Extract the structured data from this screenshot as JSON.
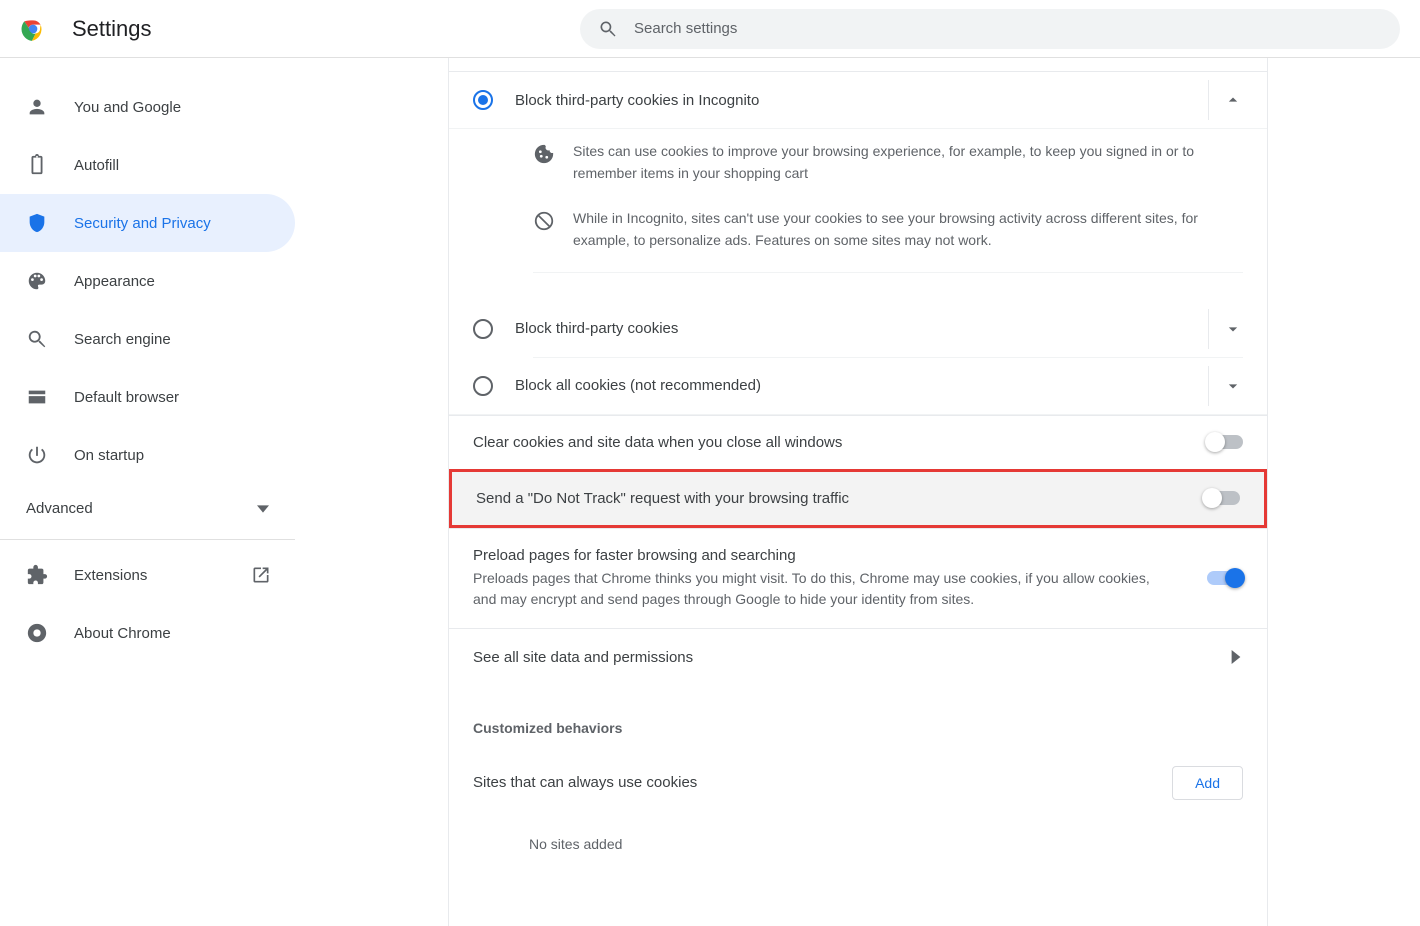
{
  "header": {
    "title": "Settings",
    "search_placeholder": "Search settings"
  },
  "sidebar": {
    "items": [
      {
        "label": "You and Google"
      },
      {
        "label": "Autofill"
      },
      {
        "label": "Security and Privacy"
      },
      {
        "label": "Appearance"
      },
      {
        "label": "Search engine"
      },
      {
        "label": "Default browser"
      },
      {
        "label": "On startup"
      }
    ],
    "advanced_label": "Advanced",
    "extensions_label": "Extensions",
    "about_label": "About Chrome"
  },
  "cookies": {
    "opt_selected": "Block third-party cookies in Incognito",
    "opt_selected_detail1": "Sites can use cookies to improve your browsing experience, for example, to keep you signed in or to remember items in your shopping cart",
    "opt_selected_detail2": "While in Incognito, sites can't use your cookies to see your browsing activity across different sites, for example, to personalize ads. Features on some sites may not work.",
    "opt_block_third": "Block third-party cookies",
    "opt_block_all": "Block all cookies (not recommended)"
  },
  "rows": {
    "clear_on_close": "Clear cookies and site data when you close all windows",
    "do_not_track": "Send a \"Do Not Track\" request with your browsing traffic",
    "preload_title": "Preload pages for faster browsing and searching",
    "preload_desc": "Preloads pages that Chrome thinks you might visit. To do this, Chrome may use cookies, if you allow cookies, and may encrypt and send pages through Google to hide your identity from sites.",
    "see_all": "See all site data and permissions"
  },
  "custom": {
    "heading": "Customized behaviors",
    "always_cookies": "Sites that can always use cookies",
    "add_label": "Add",
    "no_sites": "No sites added"
  }
}
